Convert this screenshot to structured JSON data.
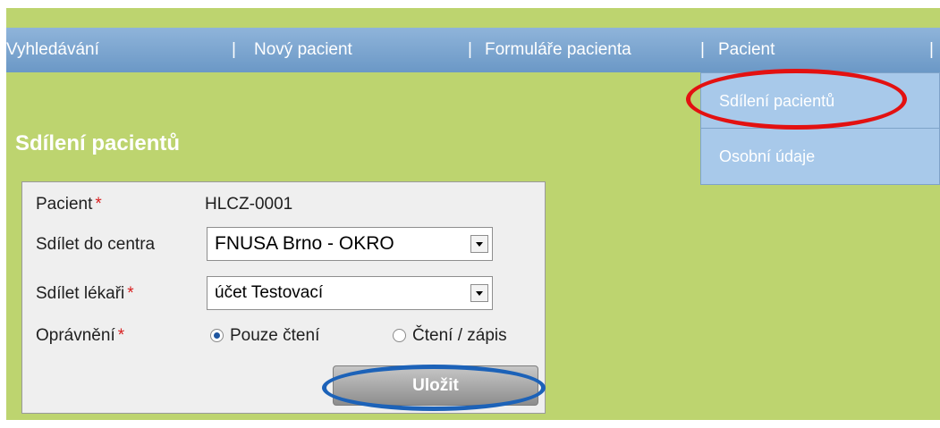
{
  "nav": {
    "items": [
      "Vyhledávání",
      "Nový pacient",
      "Formuláře pacienta",
      "Pacient"
    ],
    "separator": "|"
  },
  "dropdown": {
    "items": [
      "Sdílení pacientů",
      "Osobní údaje"
    ]
  },
  "page": {
    "title": "Sdílení pacientů"
  },
  "form": {
    "patient_label": "Pacient",
    "patient_value": "HLCZ-0001",
    "center_label": "Sdílet do centra",
    "center_value": "FNUSA Brno - OKRO",
    "doctor_label": "Sdílet lékaři",
    "doctor_value": "účet Testovací",
    "permission_label": "Oprávnění",
    "permission_options": [
      "Pouze čtení",
      "Čtení / zápis"
    ],
    "permission_selected": "Pouze čtení",
    "required_mark": "*",
    "save_label": "Uložit"
  },
  "highlights": {
    "red": "#e31111",
    "blue": "#1c62b8"
  }
}
